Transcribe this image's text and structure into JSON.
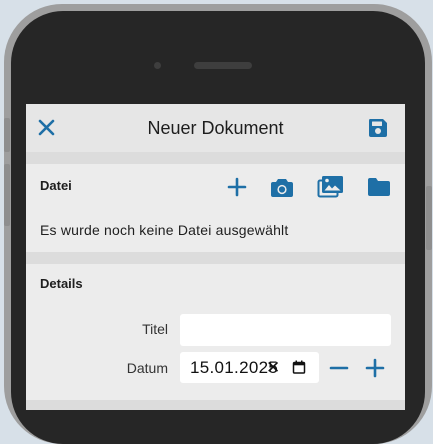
{
  "header": {
    "title": "Neuer Dokument",
    "close_icon": "close-icon",
    "save_icon": "save-icon"
  },
  "file_section": {
    "title": "Datei",
    "empty_text": "Es wurde noch keine Datei ausgewählt",
    "actions": [
      "add-icon",
      "camera-icon",
      "gallery-icon",
      "folder-icon"
    ]
  },
  "details_section": {
    "title": "Details",
    "title_label": "Titel",
    "title_value": "",
    "date_label": "Datum",
    "date_value": "15.01.2025"
  },
  "colors": {
    "accent": "#1e6fa6",
    "screen_bg": "#ececec",
    "divider": "#dcdcdc"
  }
}
